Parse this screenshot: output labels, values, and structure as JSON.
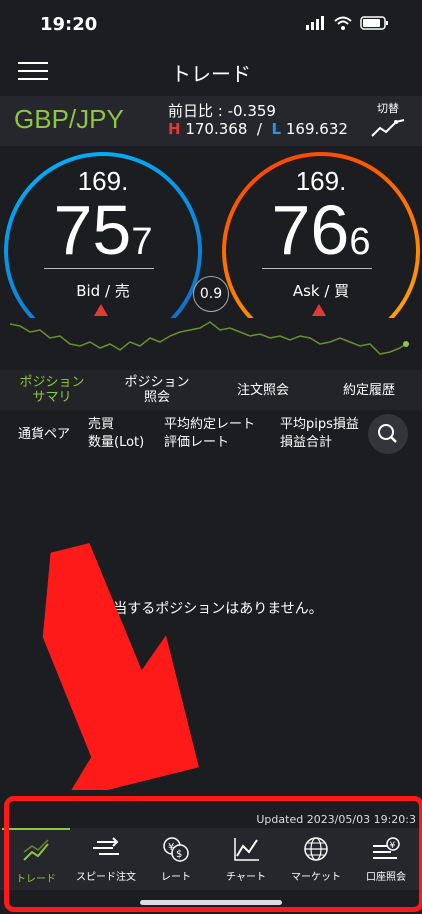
{
  "status": {
    "time": "19:20"
  },
  "header": {
    "title": "トレード"
  },
  "pair": {
    "symbol": "GBP/JPY",
    "change_label": "前日比 : -0.359",
    "high_prefix": "H",
    "high_value": "170.368",
    "separator": "/",
    "low_prefix": "L",
    "low_value": "169.632",
    "switch_label": "切替"
  },
  "bid": {
    "prefix": "169.",
    "main": "75",
    "sub": "7",
    "label": "Bid / 売"
  },
  "ask": {
    "prefix": "169.",
    "main": "76",
    "sub": "6",
    "label": "Ask / 買"
  },
  "spread": "0.9",
  "tabs": [
    {
      "label": "ポジション\nサマリ"
    },
    {
      "label": "ポジション\n照会"
    },
    {
      "label": "注文照会"
    },
    {
      "label": "約定履歴"
    }
  ],
  "columns": {
    "c1": "通貨ペア",
    "c2a": "売買",
    "c2b": "数量(Lot)",
    "c3a": "平均約定レート",
    "c3b": "評価レート",
    "c4a": "平均pips損益",
    "c4b": "損益合計"
  },
  "empty_message": "該当するポジションはありません。",
  "updated": "Updated  2023/05/03 19:20:3",
  "nav": [
    {
      "label": "トレード",
      "icon": "trend-icon"
    },
    {
      "label": "スピード注文",
      "icon": "speed-order-icon"
    },
    {
      "label": "レート",
      "icon": "rate-icon"
    },
    {
      "label": "チャート",
      "icon": "chart-icon"
    },
    {
      "label": "マーケット",
      "icon": "globe-icon"
    },
    {
      "label": "口座照会",
      "icon": "account-icon"
    }
  ],
  "colors": {
    "accent": "#8dc63f",
    "high": "#e53935",
    "low": "#2196f3",
    "highlight_frame": "#ff1a1a"
  }
}
